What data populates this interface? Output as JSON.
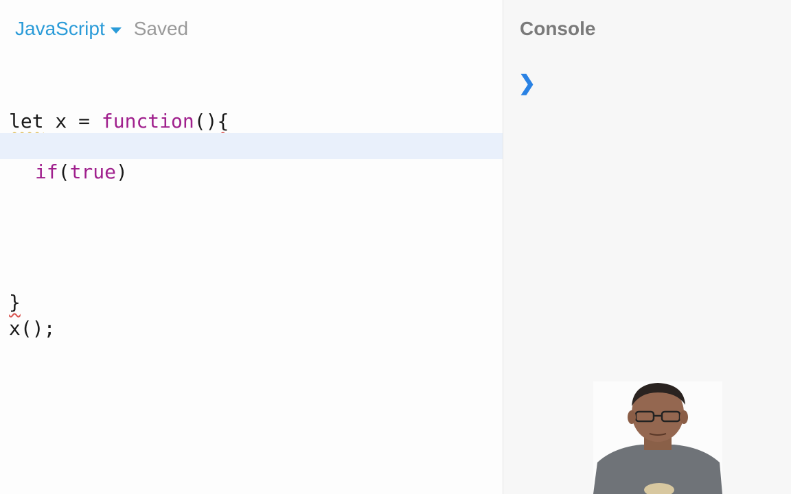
{
  "toolbar": {
    "language": "JavaScript",
    "status": "Saved"
  },
  "editor": {
    "lines": [
      {
        "a": "let",
        "b": " x = ",
        "c": "function",
        "d": "()",
        "e": "{"
      },
      {
        "a": "if",
        "b": "(",
        "c": "true",
        "d": ")"
      },
      {
        "a": "}"
      },
      {
        "a": "x();"
      }
    ]
  },
  "console": {
    "title": "Console",
    "prompt_symbol": "❯",
    "input_value": ""
  },
  "colors": {
    "accent": "#2a9bd8",
    "keyword": "#a0208d",
    "active_line": "#e9f0fb",
    "prompt": "#2a82e4"
  },
  "icons": {
    "language_dropdown": "chevron-down-icon",
    "console_prompt": "chevron-right-icon"
  }
}
